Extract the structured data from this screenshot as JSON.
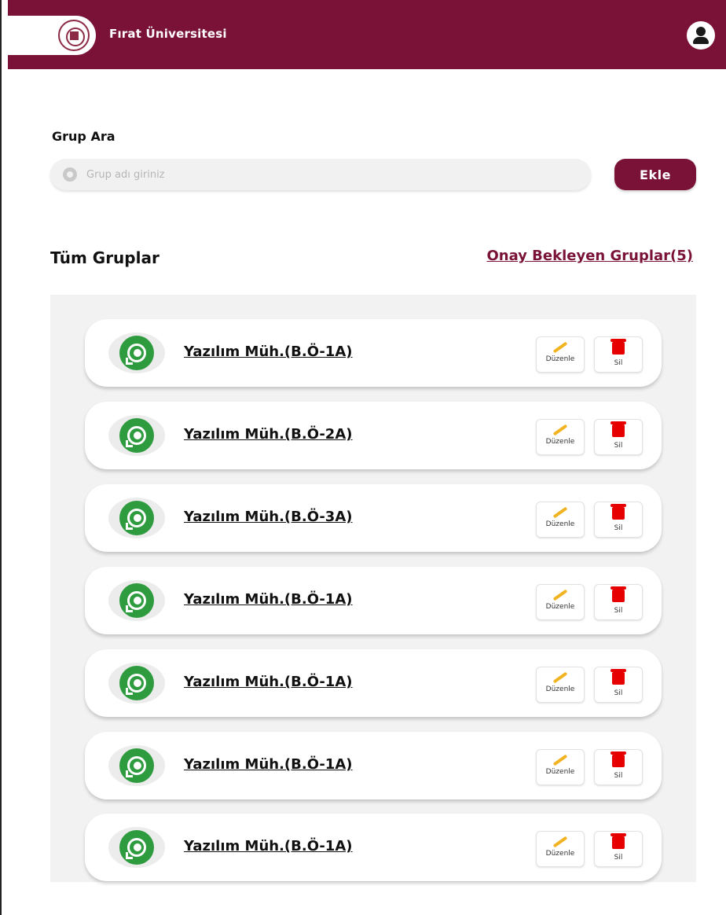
{
  "header": {
    "brand": "Fırat Üniversitesi"
  },
  "search": {
    "label": "Grup Ara",
    "placeholder": "Grup adı giriniz",
    "add_label": "Ekle"
  },
  "groups": {
    "title": "Tüm Gruplar",
    "pending_link": "Onay Bekleyen Gruplar(5)",
    "items": [
      {
        "name": "Yazılım Müh.(B.Ö-1A)"
      },
      {
        "name": "Yazılım Müh.(B.Ö-2A)"
      },
      {
        "name": "Yazılım Müh.(B.Ö-3A)"
      },
      {
        "name": "Yazılım Müh.(B.Ö-1A)"
      },
      {
        "name": "Yazılım Müh.(B.Ö-1A)"
      },
      {
        "name": "Yazılım Müh.(B.Ö-1A)"
      },
      {
        "name": "Yazılım Müh.(B.Ö-1A)"
      }
    ],
    "edit_label": "Düzenle",
    "delete_label": "Sil"
  },
  "colors": {
    "brand": "#7a1237",
    "whatsapp": "#2e9b3f",
    "edit": "#f2b320",
    "delete": "#e60000"
  }
}
